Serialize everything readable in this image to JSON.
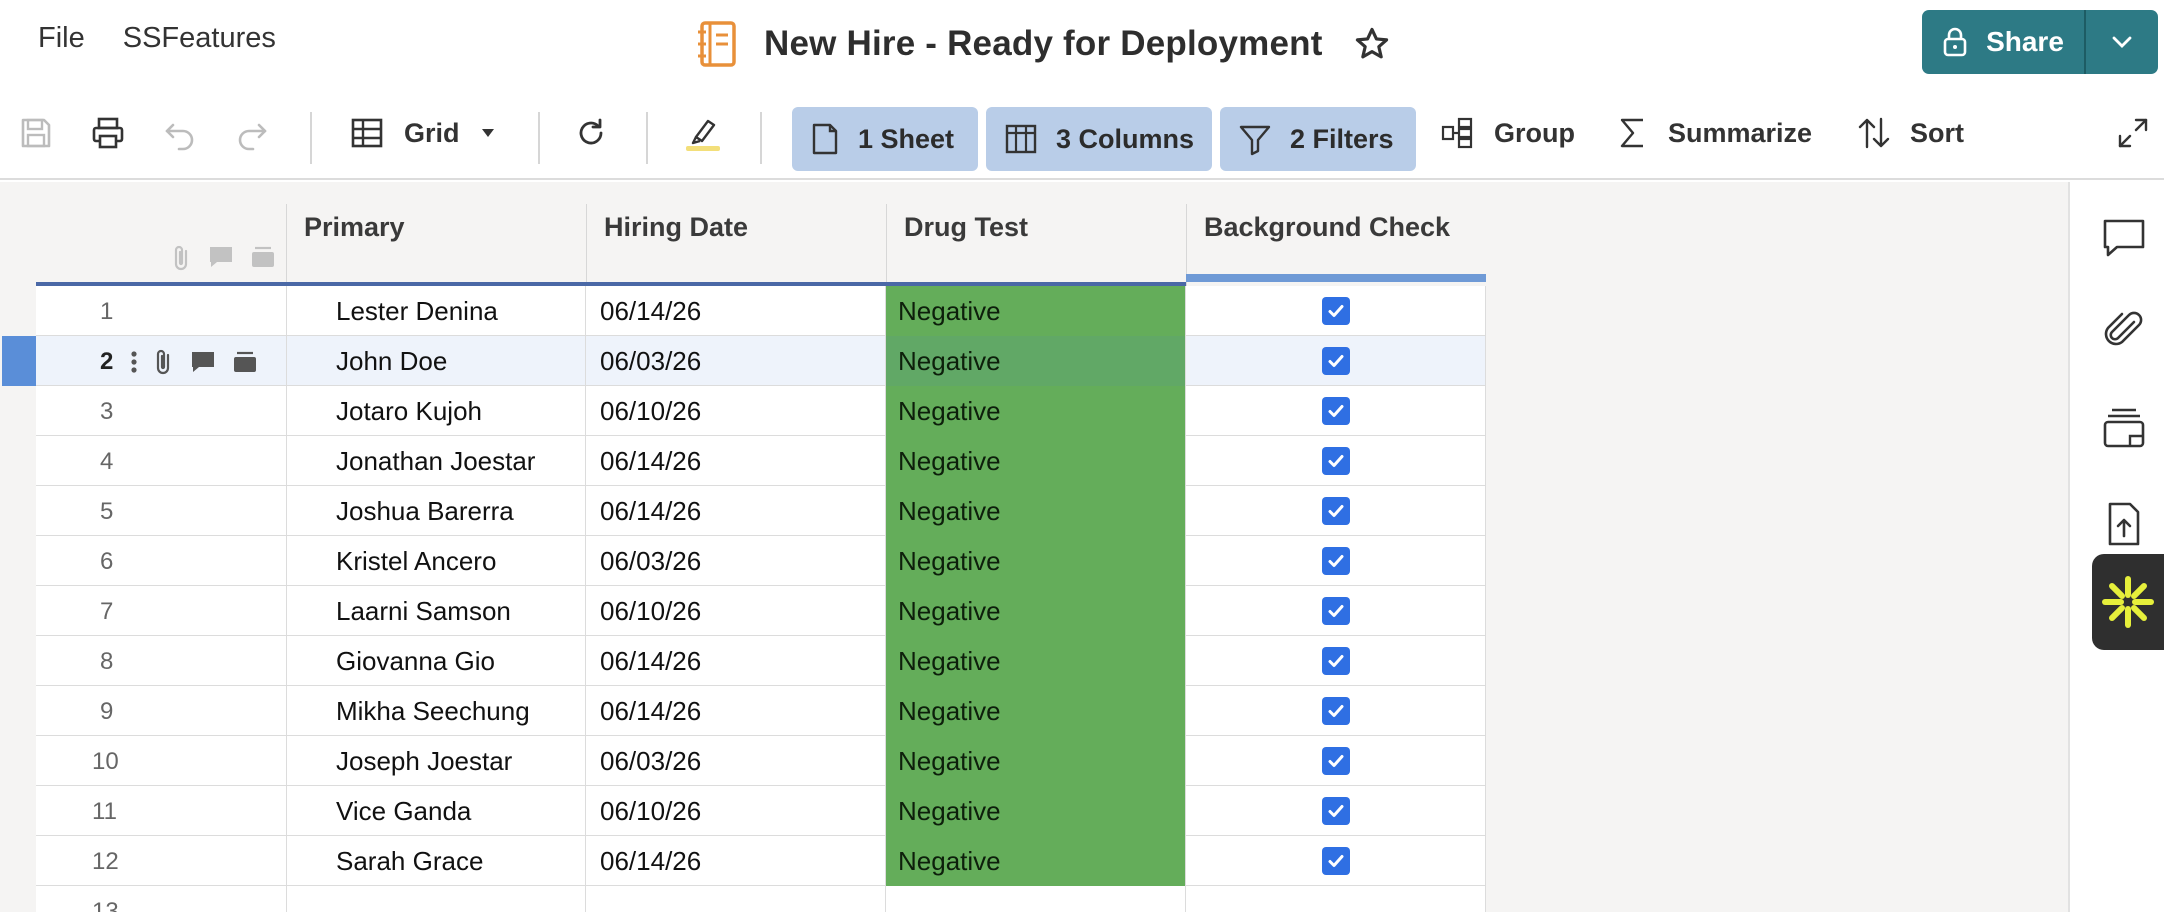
{
  "menu": {
    "file": "File",
    "features": "SSFeatures"
  },
  "title": "New Hire - Ready for Deployment",
  "share": {
    "label": "Share"
  },
  "toolbar": {
    "view_label": "Grid",
    "sheet_pill": "1 Sheet",
    "columns_pill": "3 Columns",
    "filters_pill": "2 Filters",
    "group_label": "Group",
    "summarize_label": "Summarize",
    "sort_label": "Sort"
  },
  "columns": [
    "Primary",
    "Hiring Date",
    "Drug Test",
    "Background Check"
  ],
  "rows": [
    {
      "num": "1",
      "primary": "Lester Denina",
      "date": "06/14/26",
      "drug": "Negative",
      "bg": true
    },
    {
      "num": "2",
      "primary": "John Doe",
      "date": "06/03/26",
      "drug": "Negative",
      "bg": true
    },
    {
      "num": "3",
      "primary": "Jotaro Kujoh",
      "date": "06/10/26",
      "drug": "Negative",
      "bg": true
    },
    {
      "num": "4",
      "primary": "Jonathan Joestar",
      "date": "06/14/26",
      "drug": "Negative",
      "bg": true
    },
    {
      "num": "5",
      "primary": "Joshua Barerra",
      "date": "06/14/26",
      "drug": "Negative",
      "bg": true
    },
    {
      "num": "6",
      "primary": "Kristel Ancero",
      "date": "06/03/26",
      "drug": "Negative",
      "bg": true
    },
    {
      "num": "7",
      "primary": "Laarni Samson",
      "date": "06/10/26",
      "drug": "Negative",
      "bg": true
    },
    {
      "num": "8",
      "primary": "Giovanna Gio",
      "date": "06/14/26",
      "drug": "Negative",
      "bg": true
    },
    {
      "num": "9",
      "primary": "Mikha Seechung",
      "date": "06/14/26",
      "drug": "Negative",
      "bg": true
    },
    {
      "num": "10",
      "primary": "Joseph Joestar",
      "date": "06/03/26",
      "drug": "Negative",
      "bg": true
    },
    {
      "num": "11",
      "primary": "Vice Ganda",
      "date": "06/10/26",
      "drug": "Negative",
      "bg": true
    },
    {
      "num": "12",
      "primary": "Sarah Grace",
      "date": "06/14/26",
      "drug": "Negative",
      "bg": true
    },
    {
      "num": "13",
      "primary": "",
      "date": "",
      "drug": "",
      "bg": false
    }
  ],
  "selected_row": "2",
  "colors": {
    "accent": "#2d7a85",
    "pill": "#b9cde8",
    "negative": "#64ad5a",
    "checkbox": "#2f6fe3",
    "selection": "#5a8ed8"
  }
}
